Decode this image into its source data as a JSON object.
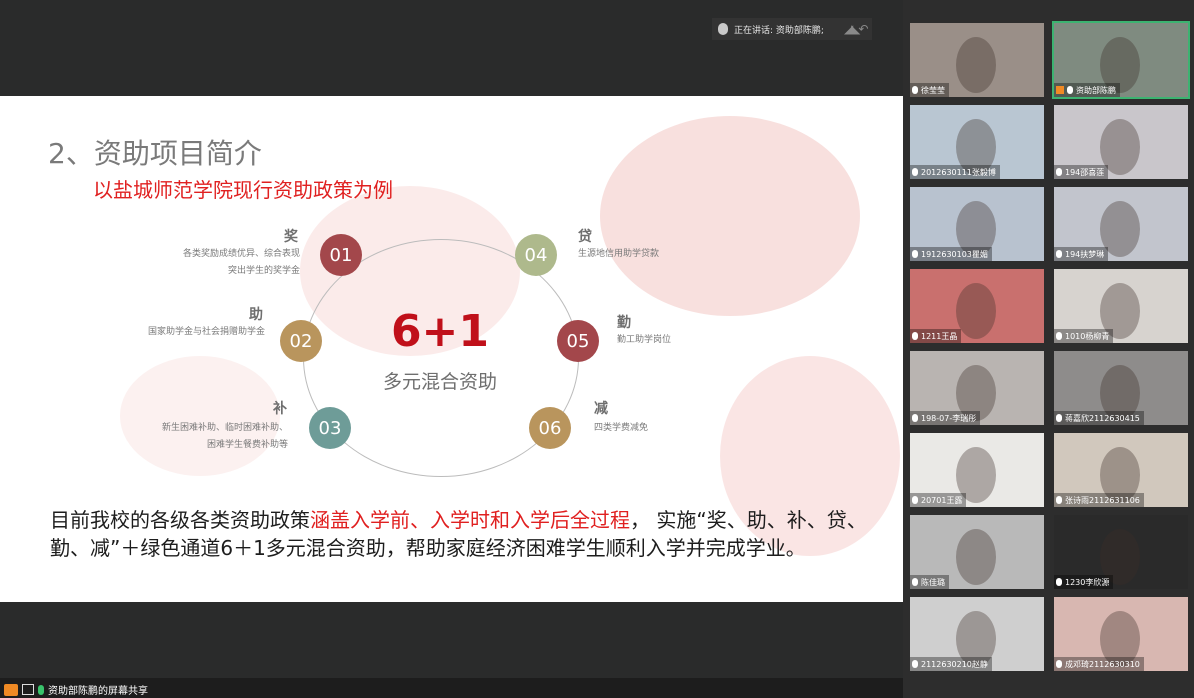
{
  "topbar": {
    "speaking_label": "正在讲话: 资助部陈鹏;"
  },
  "slide": {
    "title": "2、资助项目简介",
    "subtitle": "以盐城师范学院现行资助政策为例",
    "center_main": "6+1",
    "center_sub": "多元混合资助",
    "items": [
      {
        "num": "01",
        "title": "奖",
        "desc1": "各类奖励成绩优异、综合表现",
        "desc2": "突出学生的奖学金",
        "color": "#a3474b"
      },
      {
        "num": "02",
        "title": "助",
        "desc1": "国家助学金与社会捐赠助学金",
        "desc2": "",
        "color": "#b9955d"
      },
      {
        "num": "03",
        "title": "补",
        "desc1": "新生困难补助、临时困难补助、",
        "desc2": "困难学生餐费补助等",
        "color": "#6e9c98"
      },
      {
        "num": "04",
        "title": "贷",
        "desc1": "生源地信用助学贷款",
        "desc2": "",
        "color": "#aeb98c"
      },
      {
        "num": "05",
        "title": "勤",
        "desc1": "勤工助学岗位",
        "desc2": "",
        "color": "#a3474b"
      },
      {
        "num": "06",
        "title": "减",
        "desc1": "四类学费减免",
        "desc2": "",
        "color": "#b9955d"
      }
    ],
    "body": {
      "part1": "目前我校的各级各类资助政策",
      "highlight": "涵盖入学前、入学时和入学后全过程",
      "part2": "，  实施“奖、助、补、贷、勤、减”＋绿色通道6＋1多元混合资助，帮助家庭经济困难学生顺利入学并完成学业。"
    }
  },
  "bottombar": {
    "share_label": "资助部陈鹏的屏幕共享"
  },
  "participants": [
    {
      "name": "徐莹莹",
      "bg": "#9a8f88"
    },
    {
      "name": "资助部陈鹏",
      "bg": "#7f8b80",
      "active": true
    },
    {
      "name": "2012630111张毅博",
      "bg": "#b9c6d2"
    },
    {
      "name": "194邵喜莲",
      "bg": "#c9c6cb"
    },
    {
      "name": "1912630103瞿媚",
      "bg": "#b8c2cf"
    },
    {
      "name": "194扶梦琳",
      "bg": "#c2c5cd"
    },
    {
      "name": "1211王晶",
      "bg": "#c9706e"
    },
    {
      "name": "1010杨柳青",
      "bg": "#d7d3cf"
    },
    {
      "name": "198-07-李瑞彤",
      "bg": "#b9b4b1"
    },
    {
      "name": "蒋嘉欣2112630415",
      "bg": "#8e8c8b"
    },
    {
      "name": "20701王露",
      "bg": "#eae9e6"
    },
    {
      "name": "张诗雨2112631106",
      "bg": "#d1c8bd"
    },
    {
      "name": "陈佳璐",
      "bg": "#b9b9b9"
    },
    {
      "name": "1230李欣源",
      "bg": "#2a2a2a"
    },
    {
      "name": "2112630210赵静",
      "bg": "#cfcfcf"
    },
    {
      "name": "成邓琦2112630310",
      "bg": "#d8b7b1"
    }
  ]
}
